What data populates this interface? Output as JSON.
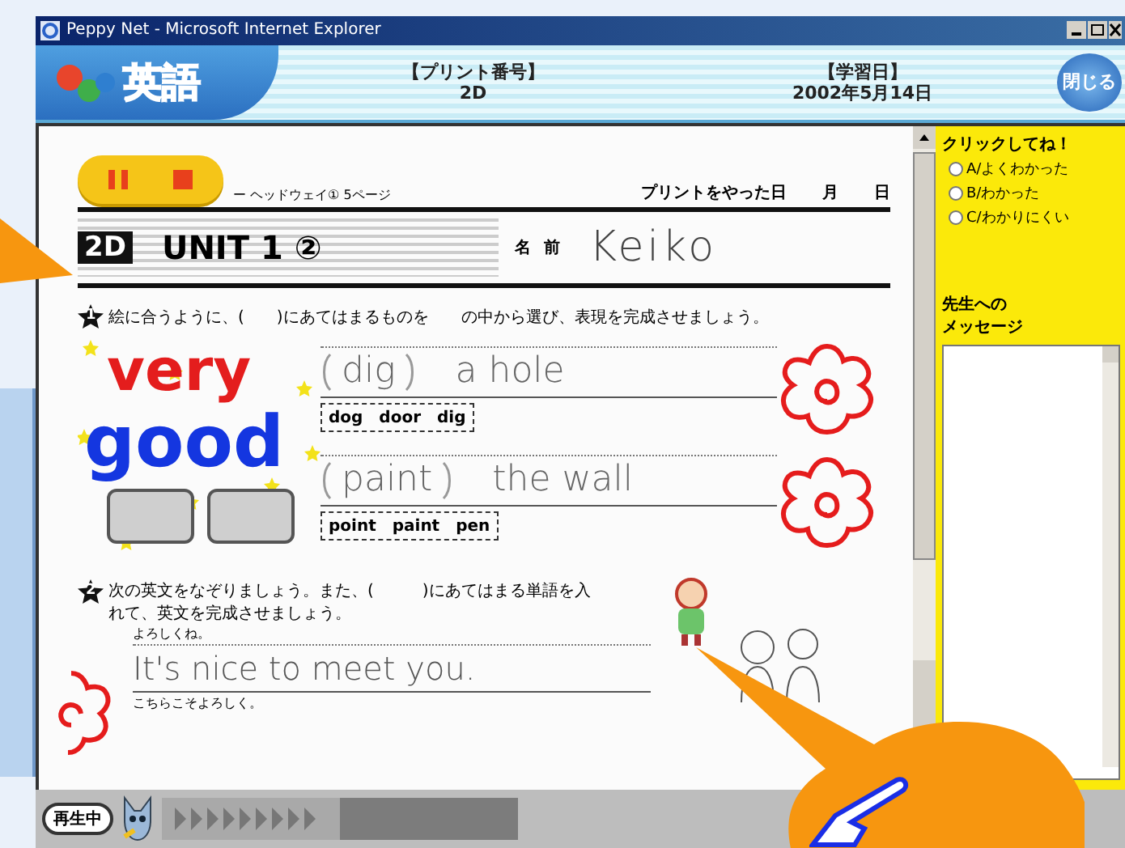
{
  "window": {
    "title": "Peppy Net - Microsoft Internet Explorer"
  },
  "header": {
    "subject": "英語",
    "print_number_label": "【プリント番号】",
    "print_number": "2D",
    "date_label": "【学習日】",
    "date": "2002年5月14日",
    "close_button": "閉じる"
  },
  "player_controls": [
    {
      "kind": "pause"
    },
    {
      "kind": "stop"
    }
  ],
  "worksheet": {
    "textbook": "ー ヘッドウェイ① 5ページ",
    "done_label": "プリントをやった日",
    "month": "月",
    "day": "日",
    "code": "2D",
    "unit": "UNIT 1 ②",
    "name_label": "名前",
    "name": "Keiko",
    "comment": [
      "very",
      "good"
    ],
    "question_1": {
      "number": "1",
      "instruction": "絵に合うように、(　　)にあてはまるものを　　の中から選び、表現を完成させましょう。",
      "items": [
        {
          "answer": "dig",
          "phrase": "a hole",
          "choices": "dog　door　dig"
        },
        {
          "answer": "paint",
          "phrase": "the wall",
          "choices": "point　paint　pen"
        }
      ]
    },
    "question_2": {
      "number": "2",
      "instruction": "次の英文をなぞりましょう。また、(　　　)にあてはまる単語を入れて、英文を完成させましょう。",
      "lines": [
        {
          "prompt": "よろしくね。",
          "trace": "It's nice to meet you."
        },
        {
          "prompt": "こちらこそよろしく。"
        }
      ]
    }
  },
  "feedback": {
    "prompt": "クリックしてね！",
    "options": [
      {
        "label": "A/よくわかった",
        "selected": false
      },
      {
        "label": "B/わかった",
        "selected": false
      },
      {
        "label": "C/わかりにくい",
        "selected": false
      }
    ],
    "message_label": [
      "先生への",
      "メッセージ"
    ]
  },
  "player": {
    "status": "再生中"
  }
}
